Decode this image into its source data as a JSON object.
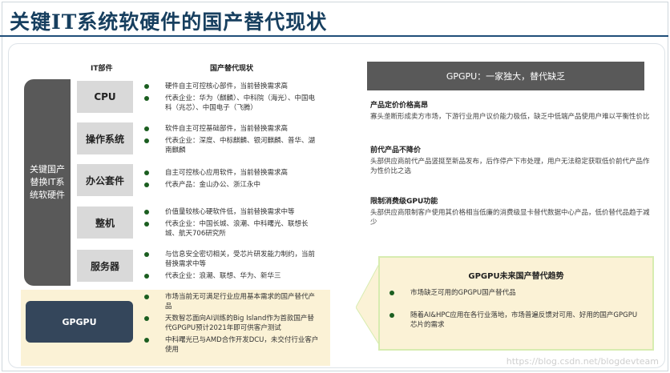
{
  "page": {
    "title": "关键IT系统软硬件的国产替代现状"
  },
  "table": {
    "col_header_part": "IT部件",
    "col_header_status": "国产替代现状",
    "group_label": "关键国产替换IT系统软硬件",
    "rows": [
      {
        "name": "CPU",
        "bullets": [
          "硬件自主可控核心部件，当前替换需求高",
          "代表企业：华为（麒麟）、中科院（海光）、中国电科（兆芯）、中国电子（飞腾）"
        ]
      },
      {
        "name": "操作系统",
        "bullets": [
          "软件自主可控基础部件，当前替换需求高",
          "代表企业：深度、中标麒麟、银河麒麟、普华、湖南麒麟"
        ]
      },
      {
        "name": "办公套件",
        "bullets": [
          "自主可控核心应用软件，当前替换需求高",
          "代表产品：金山办公、浙江永中"
        ]
      },
      {
        "name": "整机",
        "bullets": [
          "价值量较核心硬软件低，当前替换需求中等",
          "代表企业：中国长城、浪潮、中科曙光、联想长城、航天706研究所"
        ]
      },
      {
        "name": "服务器",
        "bullets": [
          "与信息安全密切相关，受芯片研发能力制约，当前替换需求中等",
          "代表企业：浪潮、联想、华为、新华三"
        ]
      }
    ],
    "gpgpu": {
      "name": "GPGPU",
      "bullets": [
        "市场当前无可满足行业应用基本需求的国产替代产品",
        "天数智芯面向AI训练的Big Island作为首款国产替代GPGPU预计2021年即可供客户测试",
        "中科曙光已与AMD合作开发DCU，未交付行业客户使用"
      ]
    }
  },
  "right": {
    "banner": "GPGPU：一家独大，替代缺乏",
    "sections": [
      {
        "heading": "产品定价价格高昂",
        "body": "寡头垄断形成卖方市场，下游行业用户议价能力极低，缺乏中低端产品使用户难以平衡性价比"
      },
      {
        "heading": "前代产品不降价",
        "body": "头部供应商前代产品竖挺至新品发布，后作停产下市处理，用户无法稳定获取低价前代产品作为性价比之选"
      },
      {
        "heading": "限制消费级GPU功能",
        "body": "头部供应商限制客户使用其价格相当低廉的消费级显卡替代数据中心产品，低价替代品趋于减少"
      }
    ],
    "trend": {
      "heading": "GPGPU未来国产替代趋势",
      "bullets": [
        "市场缺乏可用的GPGPU国产替代品",
        "随着AI&HPC应用在各行业落地，市场普遍反馈对可用、好用的国产GPGPU芯片的需求"
      ]
    }
  },
  "watermark": "https://blog.csdn.net/blogdevteam",
  "colors": {
    "navy": "#1f4e79",
    "dark_gray": "#595959",
    "light_gray": "#d9d9d9",
    "cream": "#fbf2d6",
    "bullet_green": "#1b5e20",
    "gpgpu_box": "#34465b"
  }
}
